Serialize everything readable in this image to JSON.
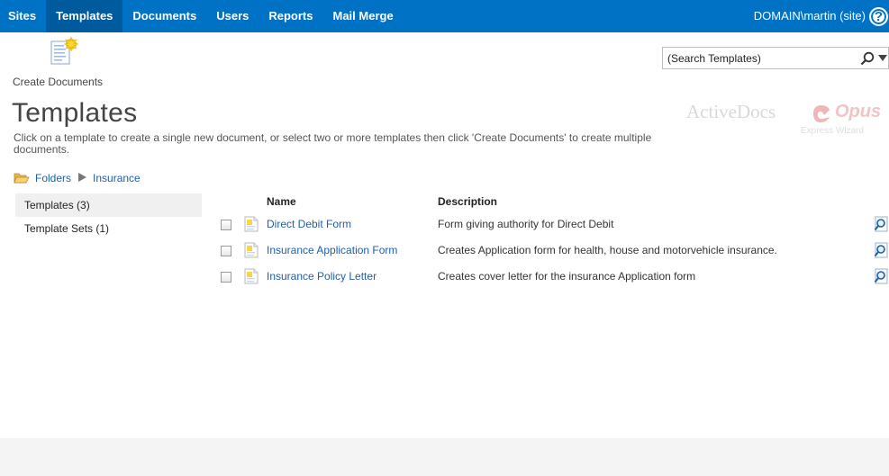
{
  "nav": {
    "tabs": [
      {
        "label": "Sites",
        "active": false
      },
      {
        "label": "Templates",
        "active": true
      },
      {
        "label": "Documents",
        "active": false
      },
      {
        "label": "Users",
        "active": false
      },
      {
        "label": "Reports",
        "active": false
      },
      {
        "label": "Mail Merge",
        "active": false
      }
    ],
    "user": "DOMAIN\\martin (site)",
    "help": "?"
  },
  "ribbon": {
    "create_documents_label": "Create Documents"
  },
  "search": {
    "value": "(Search Templates)"
  },
  "page": {
    "title": "Templates",
    "instructions": "Click on a template to create a single new document, or select two or more templates then click 'Create Documents' to create multiple documents."
  },
  "brand": {
    "name": "ActiveDocs",
    "product": "Opus",
    "subtitle": "Express Wizard"
  },
  "breadcrumb": {
    "items": [
      "Folders",
      "Insurance"
    ]
  },
  "leftnav": {
    "items": [
      {
        "label": "Templates (3)",
        "selected": true
      },
      {
        "label": "Template Sets (1)",
        "selected": false
      }
    ]
  },
  "table": {
    "columns": {
      "name": "Name",
      "description": "Description"
    },
    "rows": [
      {
        "name": "Direct Debit Form",
        "description": "Form giving authority for Direct Debit"
      },
      {
        "name": "Insurance Application Form",
        "description": "Creates Application form for health, house and motorvehicle insurance."
      },
      {
        "name": "Insurance Policy Letter",
        "description": "Creates cover letter for the insurance Application form"
      }
    ]
  },
  "colors": {
    "nav_bg": "#0072c6",
    "nav_active": "#005a9e",
    "link": "#1f5fa8"
  }
}
